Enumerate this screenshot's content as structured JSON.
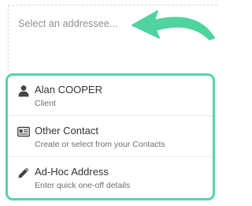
{
  "addressee": {
    "placeholder": "Select an addressee..."
  },
  "hint": {
    "icon": "curved-arrow-icon",
    "color": "#55d6a5"
  },
  "options": [
    {
      "title": "Alan COOPER",
      "subtitle": "Client",
      "icon": "person-icon"
    },
    {
      "title": "Other Contact",
      "subtitle": "Create or select from your Contacts",
      "icon": "contact-card-icon"
    },
    {
      "title": "Ad-Hoc Address",
      "subtitle": "Enter quick one-off details",
      "icon": "pencil-icon"
    }
  ],
  "colors": {
    "accent": "#55d6a5",
    "text": "#333333",
    "subtext": "#6f6f6f",
    "placeholder": "#8f8f8f"
  }
}
